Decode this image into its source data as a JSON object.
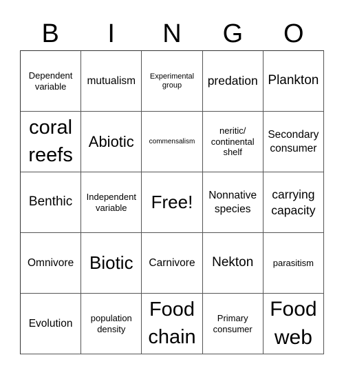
{
  "header": {
    "letters": [
      "B",
      "I",
      "N",
      "G",
      "O"
    ]
  },
  "cells": [
    [
      "Dependent variable",
      "mutualism",
      "Experimental group",
      "predation",
      "Plankton"
    ],
    [
      "coral reefs",
      "Abiotic",
      "commensalism",
      "neritic/ continental shelf",
      "Secondary consumer"
    ],
    [
      "Benthic",
      "Independent variable",
      "Free!",
      "Nonnative species",
      "carrying capacity"
    ],
    [
      "Omnivore",
      "Biotic",
      "Carnivore",
      "Nekton",
      "parasitism"
    ],
    [
      "Evolution",
      "population density",
      "Food chain",
      "Primary consumer",
      "Food web"
    ]
  ]
}
